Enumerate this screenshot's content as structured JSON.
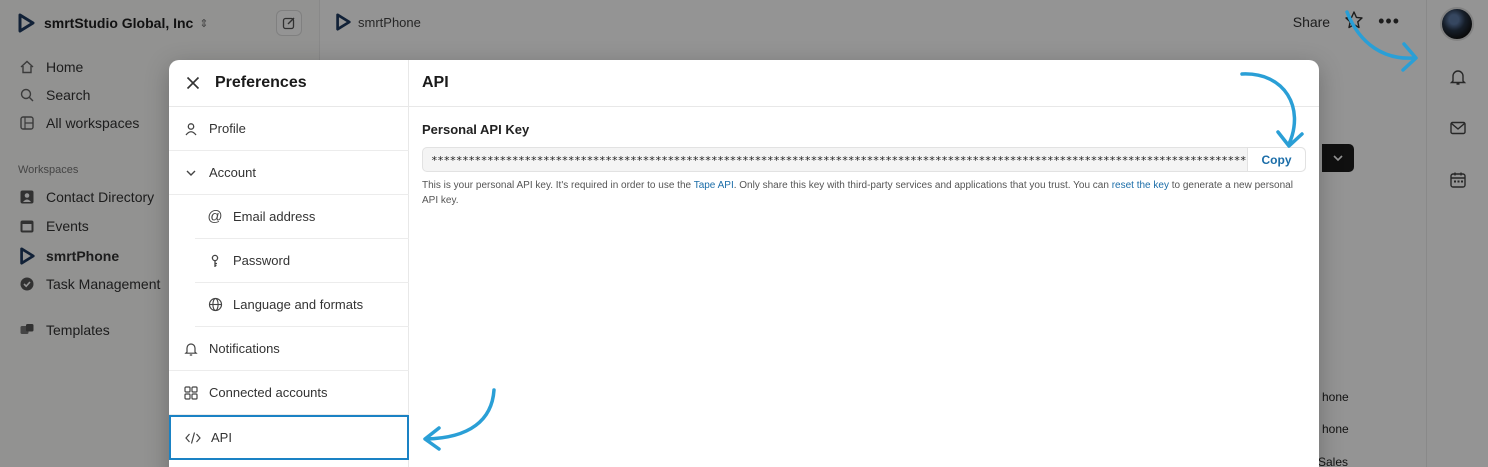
{
  "sidebar": {
    "org_name": "smrtStudio Global, Inc",
    "nav": [
      {
        "label": "Home",
        "icon": "home-icon"
      },
      {
        "label": "Search",
        "icon": "search-icon"
      },
      {
        "label": "All workspaces",
        "icon": "workspaces-icon"
      }
    ],
    "section_label": "Workspaces",
    "workspaces": [
      {
        "label": "Contact Directory",
        "icon": "person-icon"
      },
      {
        "label": "Events",
        "icon": "calendar-icon"
      },
      {
        "label": "smrtPhone",
        "icon": "smrtphone-logo-icon"
      },
      {
        "label": "Task Management",
        "icon": "check-circle-icon"
      }
    ],
    "templates_label": "Templates"
  },
  "topbar": {
    "app_name": "smrtPhone",
    "share_label": "Share"
  },
  "background_fragments": {
    "row1": "hone",
    "row2": "hone",
    "row3": "Sales"
  },
  "modal": {
    "title": "Preferences",
    "nav": {
      "profile": "Profile",
      "account": "Account",
      "email": "Email address",
      "password": "Password",
      "language": "Language and formats",
      "notifications": "Notifications",
      "connected": "Connected accounts",
      "api": "API"
    },
    "content": {
      "heading": "API",
      "field_label": "Personal API Key",
      "api_key_masked": "**************************************************************************************************************************************",
      "copy_label": "Copy",
      "help_1": "This is your personal API key. It's required in order to use the ",
      "help_link_1": "Tape API",
      "help_2": ". Only share this key with third-party services and applications that you trust. You can ",
      "help_link_2": "reset the key",
      "help_3": " to generate a new personal API key."
    }
  },
  "colors": {
    "accent": "#1a82c4",
    "link": "#1b6da8",
    "arrow": "#2a9fd6"
  }
}
